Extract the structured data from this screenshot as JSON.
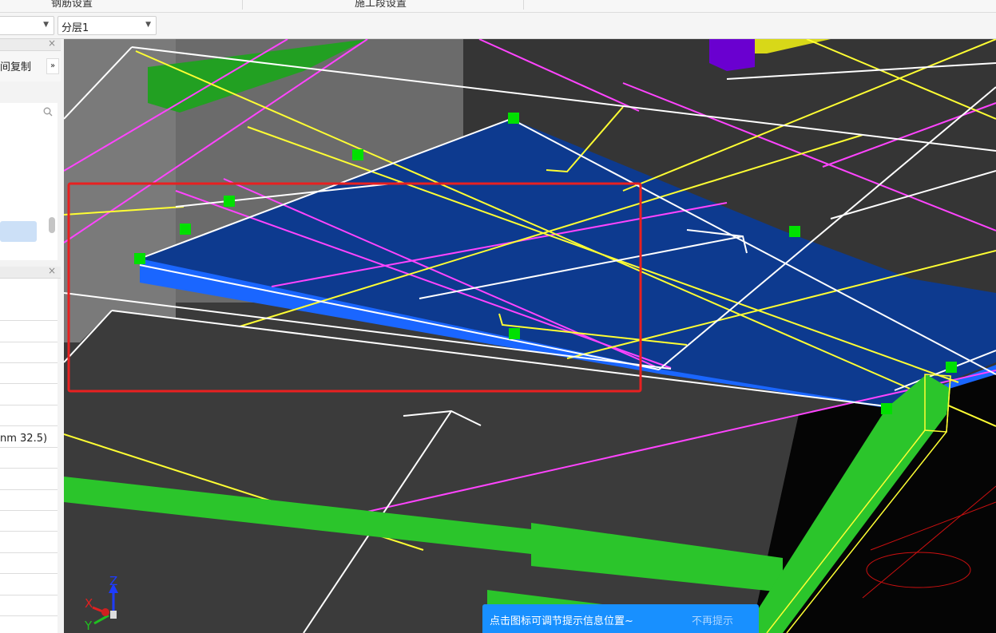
{
  "top_tabs": [
    "钢筋设置",
    "施工段设置"
  ],
  "toolbar": {
    "combo1_value": "",
    "floor_combo_value": "分层1"
  },
  "left_panel": {
    "copy_label": "间复制",
    "expand_glyph": "»",
    "search_icon": "search-icon",
    "close_glyph": "×",
    "property_value": "nm 32.5)"
  },
  "hint": {
    "message": "点击图标可调节提示信息位置~",
    "dismiss": "不再提示"
  },
  "axis": {
    "x": "X",
    "y": "Y",
    "z": "Z"
  },
  "colors": {
    "slab_top": "#0d3a8f",
    "slab_edge": "#1a66ff",
    "grips": "#00e000",
    "beam": "#2bc52b",
    "selection": "#e02020",
    "hint_bg": "#1890ff",
    "magenta_lines": "#ff44ff",
    "yellow_lines": "#ffff33"
  }
}
